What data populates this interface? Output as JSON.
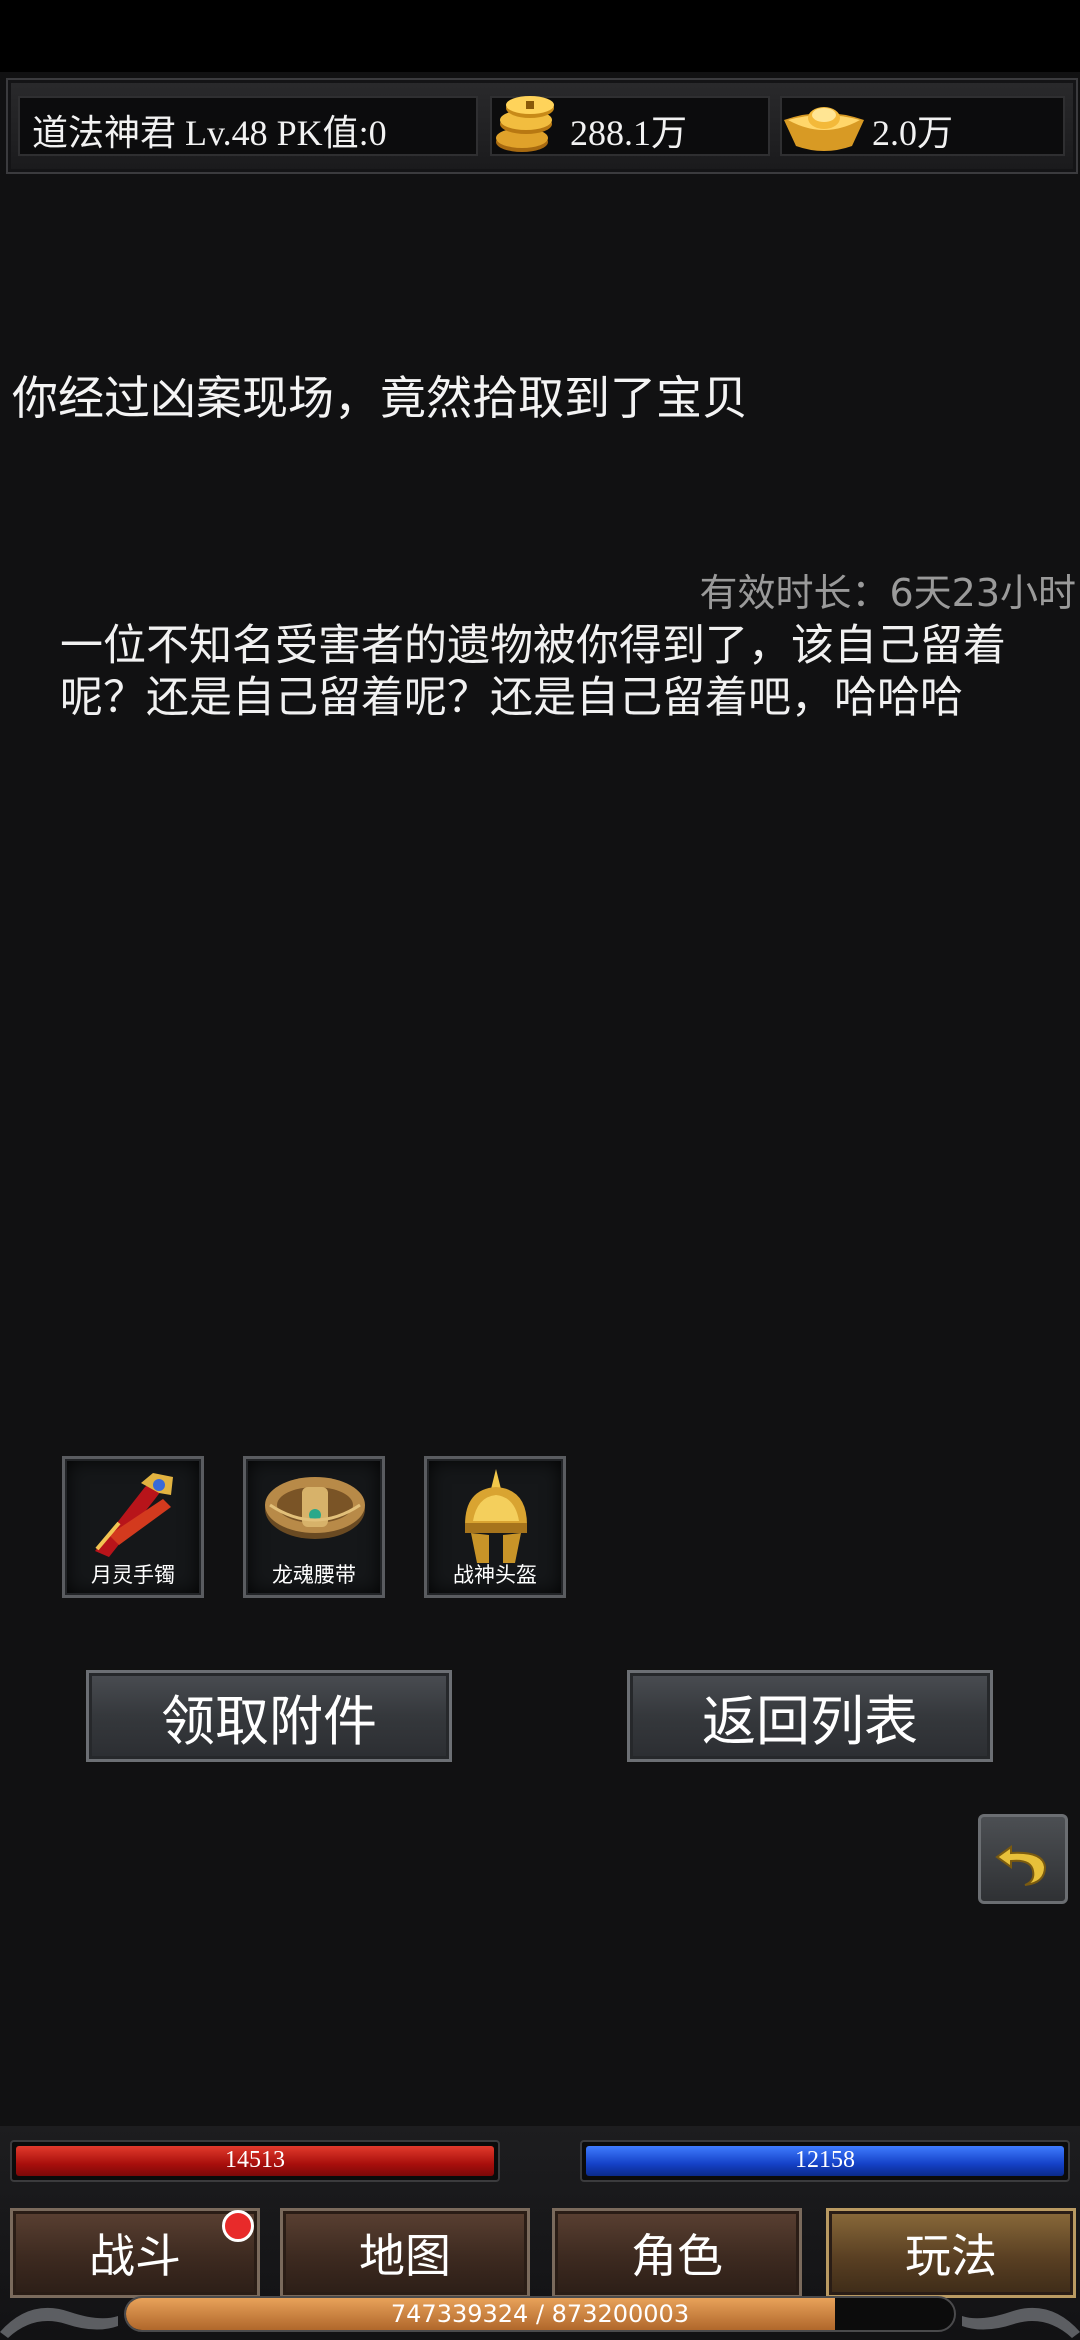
{
  "header": {
    "player_info": "道法神君  Lv.48 PK值:0",
    "gold": "288.1万",
    "ingot": "2.0万"
  },
  "mail": {
    "subject": "你经过凶案现场，竟然拾取到了宝贝",
    "validity": "有效时长：6天23小时",
    "body": "一位不知名受害者的遗物被你得到了，该自己留着呢？还是自己留着呢？还是自己留着吧，哈哈哈",
    "attachments": [
      {
        "name": "月灵手镯",
        "icon": "bracelet-icon"
      },
      {
        "name": "龙魂腰带",
        "icon": "belt-icon"
      },
      {
        "name": "战神头盔",
        "icon": "helmet-icon"
      }
    ],
    "claim_label": "领取附件",
    "back_label": "返回列表"
  },
  "hud": {
    "hp": "14513",
    "mp": "12158",
    "tabs": [
      "战斗",
      "地图",
      "角色",
      "玩法"
    ],
    "active_tab": "玩法",
    "exp_text": "747339324 / 873200003",
    "exp_ratio": 0.856
  },
  "colors": {
    "hp": "#b3120e",
    "mp": "#1848d2",
    "exp": "#d48a45",
    "badge": "#e82a2a"
  }
}
